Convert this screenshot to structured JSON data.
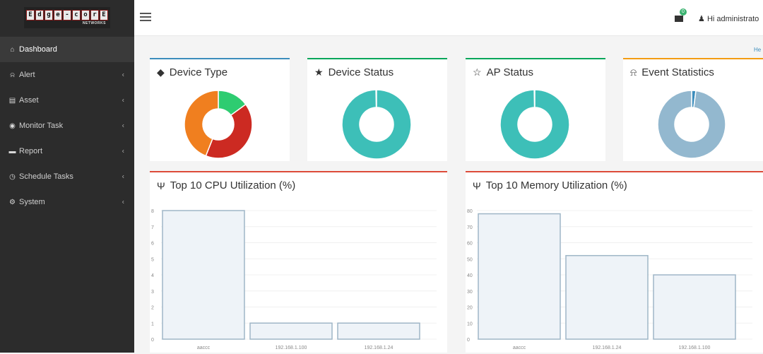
{
  "logo": {
    "letters": [
      "E",
      "d",
      "g",
      "e",
      "-",
      "c",
      "o",
      "r",
      "E"
    ],
    "sub": "NETWORKS"
  },
  "sidebar": {
    "items": [
      {
        "label": "Dashboard",
        "icon": "dashboard-icon",
        "glyph": "⌂",
        "active": true,
        "arrow": false
      },
      {
        "label": "Alert",
        "icon": "bell-icon",
        "glyph": "⍾",
        "active": false,
        "arrow": true
      },
      {
        "label": "Asset",
        "icon": "asset-icon",
        "glyph": "▤",
        "active": false,
        "arrow": true
      },
      {
        "label": "Monitor Task",
        "icon": "eye-icon",
        "glyph": "◉",
        "active": false,
        "arrow": true
      },
      {
        "label": "Report",
        "icon": "folder-icon",
        "glyph": "▬",
        "active": false,
        "arrow": true
      },
      {
        "label": "Schedule Tasks",
        "icon": "clock-icon",
        "glyph": "◷",
        "active": false,
        "arrow": true
      },
      {
        "label": "System",
        "icon": "cogs-icon",
        "glyph": "⚙",
        "active": false,
        "arrow": true
      }
    ],
    "arrow_glyph": "‹"
  },
  "topbar": {
    "user_label": "Hi administrato",
    "msg_count": "0"
  },
  "help_link": "He",
  "cards": {
    "device_type": {
      "title": "Device Type",
      "icon": "tags-icon",
      "glyph": "◆",
      "accent": "#3c8dbc"
    },
    "device_status": {
      "title": "Device Status",
      "icon": "star-icon",
      "glyph": "★",
      "accent": "#00a65a"
    },
    "ap_status": {
      "title": "AP Status",
      "icon": "star-outline-icon",
      "glyph": "☆",
      "accent": "#00a65a"
    },
    "event_statistics": {
      "title": "Event Statistics",
      "icon": "bell-icon",
      "glyph": "⍾",
      "accent": "#f39c12"
    },
    "cpu": {
      "title": "Top 10 CPU Utilization (%)",
      "icon": "thermometer-icon",
      "glyph": "Ψ",
      "accent": "#dd4b39"
    },
    "memory": {
      "title": "Top 10 Memory Utilization (%)",
      "icon": "thermometer-icon",
      "glyph": "Ψ",
      "accent": "#dd4b39"
    }
  },
  "donuts": {
    "device_type": [
      {
        "value": 0.15,
        "color": "#2ecc71"
      },
      {
        "value": 0.41,
        "color": "#cc2a22"
      },
      {
        "value": 0.44,
        "color": "#f07f1f"
      }
    ],
    "device_status": [
      {
        "value": 1.0,
        "color": "#3dbfb8"
      }
    ],
    "ap_status": [
      {
        "value": 1.0,
        "color": "#3dbfb8"
      }
    ],
    "event_statistics": [
      {
        "value": 0.02,
        "color": "#3c8dbc"
      },
      {
        "value": 0.98,
        "color": "#93b8cf"
      }
    ]
  },
  "chart_data": [
    {
      "type": "bar",
      "title": "Top 10 CPU Utilization (%)",
      "categories": [
        "aaccc",
        "192.168.1.100",
        "192.168.1.24"
      ],
      "values": [
        8,
        1,
        1
      ],
      "ylim": [
        0,
        8
      ],
      "yticks": [
        "0",
        "1",
        "2",
        "3",
        "4",
        "5",
        "6",
        "7",
        "8"
      ],
      "bar_color": "#eef3f8",
      "bar_border": "#9fb6c7"
    },
    {
      "type": "bar",
      "title": "Top 10 Memory Utilization (%)",
      "categories": [
        "aaccc",
        "192.168.1.24",
        "192.168.1.100"
      ],
      "values": [
        78,
        52,
        40
      ],
      "ylim": [
        0,
        80
      ],
      "yticks": [
        "0",
        "10",
        "20",
        "30",
        "40",
        "50",
        "60",
        "70",
        "80"
      ],
      "bar_color": "#eef3f8",
      "bar_border": "#9fb6c7"
    }
  ]
}
